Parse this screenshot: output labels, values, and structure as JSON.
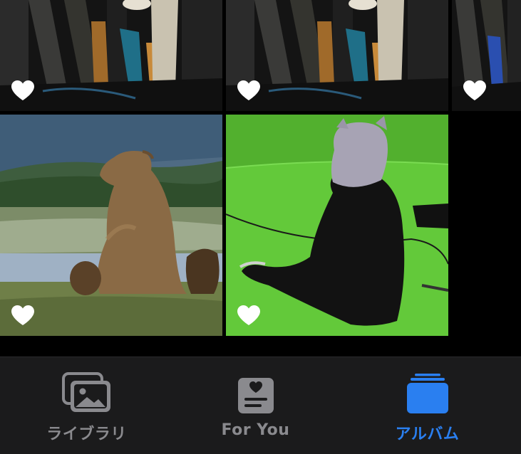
{
  "photos": [
    {
      "id": "r1c1",
      "subject": "guitar-cases",
      "favorited": true
    },
    {
      "id": "r1c2",
      "subject": "guitar-cases",
      "favorited": true
    },
    {
      "id": "r1c3",
      "subject": "guitar-cases",
      "favorited": true
    },
    {
      "id": "r2c1",
      "subject": "brown-bears-in-meadow",
      "favorited": true
    },
    {
      "id": "r2c2",
      "subject": "person-on-green-screen",
      "favorited": true
    }
  ],
  "tabs": [
    {
      "label": "ライブラリ",
      "icon": "photo-library-icon",
      "active": false
    },
    {
      "label": "For You",
      "icon": "for-you-icon",
      "active": false
    },
    {
      "label": "アルバム",
      "icon": "albums-icon",
      "active": true
    }
  ],
  "colors": {
    "background": "#000000",
    "tab_bar": "#1b1b1c",
    "inactive": "#8a8a8e",
    "accent": "#2a7ff0",
    "favorite_heart": "#ffffff"
  }
}
